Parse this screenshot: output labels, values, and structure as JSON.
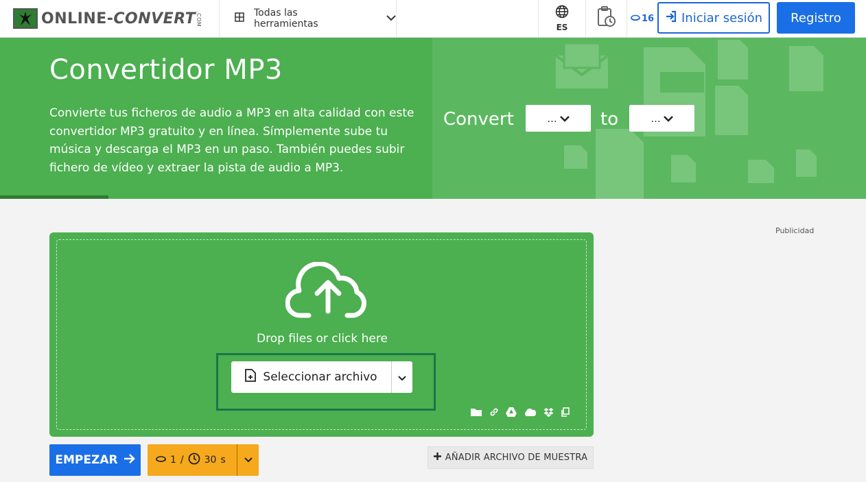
{
  "header": {
    "logo_text": "ONLINE-",
    "logo_text2": "CONVERT",
    "logo_com": ".COM",
    "tools_label": "Todas las herramientas",
    "language": "ES",
    "credits": "16",
    "login_label": "Iniciar sesión",
    "register_label": "Registro"
  },
  "hero": {
    "title": "Convertidor MP3",
    "description": "Convierte tus ficheros de audio a MP3 en alta calidad con este convertidor MP3 gratuito y en línea. Símplemente sube tu música y descarga el MP3 en un paso. También puedes subir fichero de vídeo y extraer la pista de audio a MP3.",
    "convert_label": "Convert",
    "to_label": "to",
    "from_select_value": "...",
    "to_select_value": "..."
  },
  "ad_label": "Publicidad",
  "upload": {
    "drop_text": "Drop files or click here",
    "select_label": "Seleccionar archivo"
  },
  "actions": {
    "start_label": "EMPEZAR",
    "cost_credits": "1",
    "cost_separator": "/",
    "cost_time": "30",
    "cost_unit": "s",
    "sample_label": "AÑADIR ARCHIVO DE MUESTRA"
  },
  "colors": {
    "green": "#4caf50",
    "blue": "#1a6fe6",
    "orange": "#f6a91c"
  }
}
